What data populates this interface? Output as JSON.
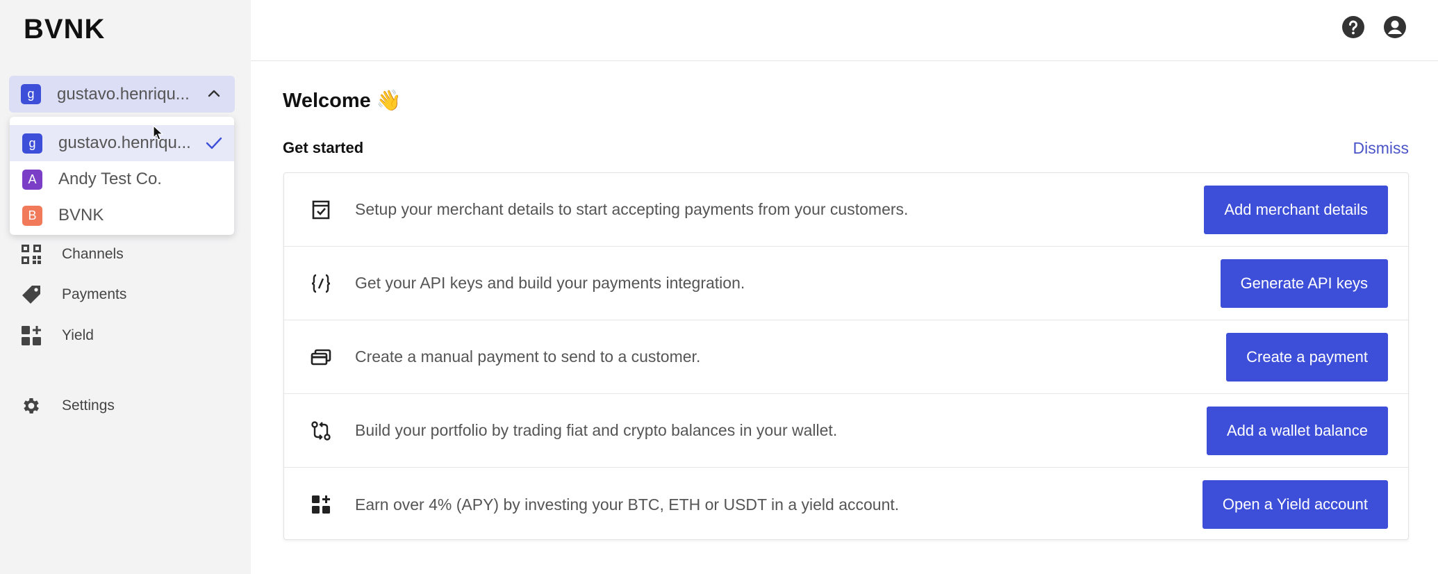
{
  "logo": "BVNK",
  "account_selector": {
    "current": {
      "initial": "g",
      "name": "gustavo.henriqu...",
      "color": "#3d4fd8"
    }
  },
  "accounts": [
    {
      "initial": "g",
      "name": "gustavo.henriqu...",
      "color": "#3d4fd8",
      "selected": true
    },
    {
      "initial": "A",
      "name": "Andy Test Co.",
      "color": "#7b3fc7",
      "selected": false
    },
    {
      "initial": "B",
      "name": "BVNK",
      "color": "#f07a5a",
      "selected": false
    }
  ],
  "nav": {
    "channels": "Channels",
    "payments": "Payments",
    "yield": "Yield",
    "settings": "Settings"
  },
  "header": {
    "help_icon": "help-icon",
    "user_icon": "account-icon"
  },
  "main": {
    "welcome": "Welcome 👋",
    "get_started": "Get started",
    "dismiss": "Dismiss",
    "tasks": [
      {
        "icon": "merchant-icon",
        "text": "Setup your merchant details to start accepting payments from your customers.",
        "button": "Add merchant details"
      },
      {
        "icon": "api-icon",
        "text": "Get your API keys and build your payments integration.",
        "button": "Generate API keys"
      },
      {
        "icon": "card-icon",
        "text": "Create a manual payment to send to a customer.",
        "button": "Create a payment"
      },
      {
        "icon": "swap-icon",
        "text": "Build your portfolio by trading fiat and crypto balances in your wallet.",
        "button": "Add a wallet balance"
      },
      {
        "icon": "yield-icon",
        "text": "Earn over 4% (APY) by investing your BTC, ETH or USDT in a yield account.",
        "button": "Open a Yield account"
      }
    ]
  },
  "colors": {
    "accent": "#3d4fd8",
    "sidebar_bg": "#f3f3f4",
    "selector_bg": "#dcdef5",
    "dismiss": "#4a54c8"
  }
}
